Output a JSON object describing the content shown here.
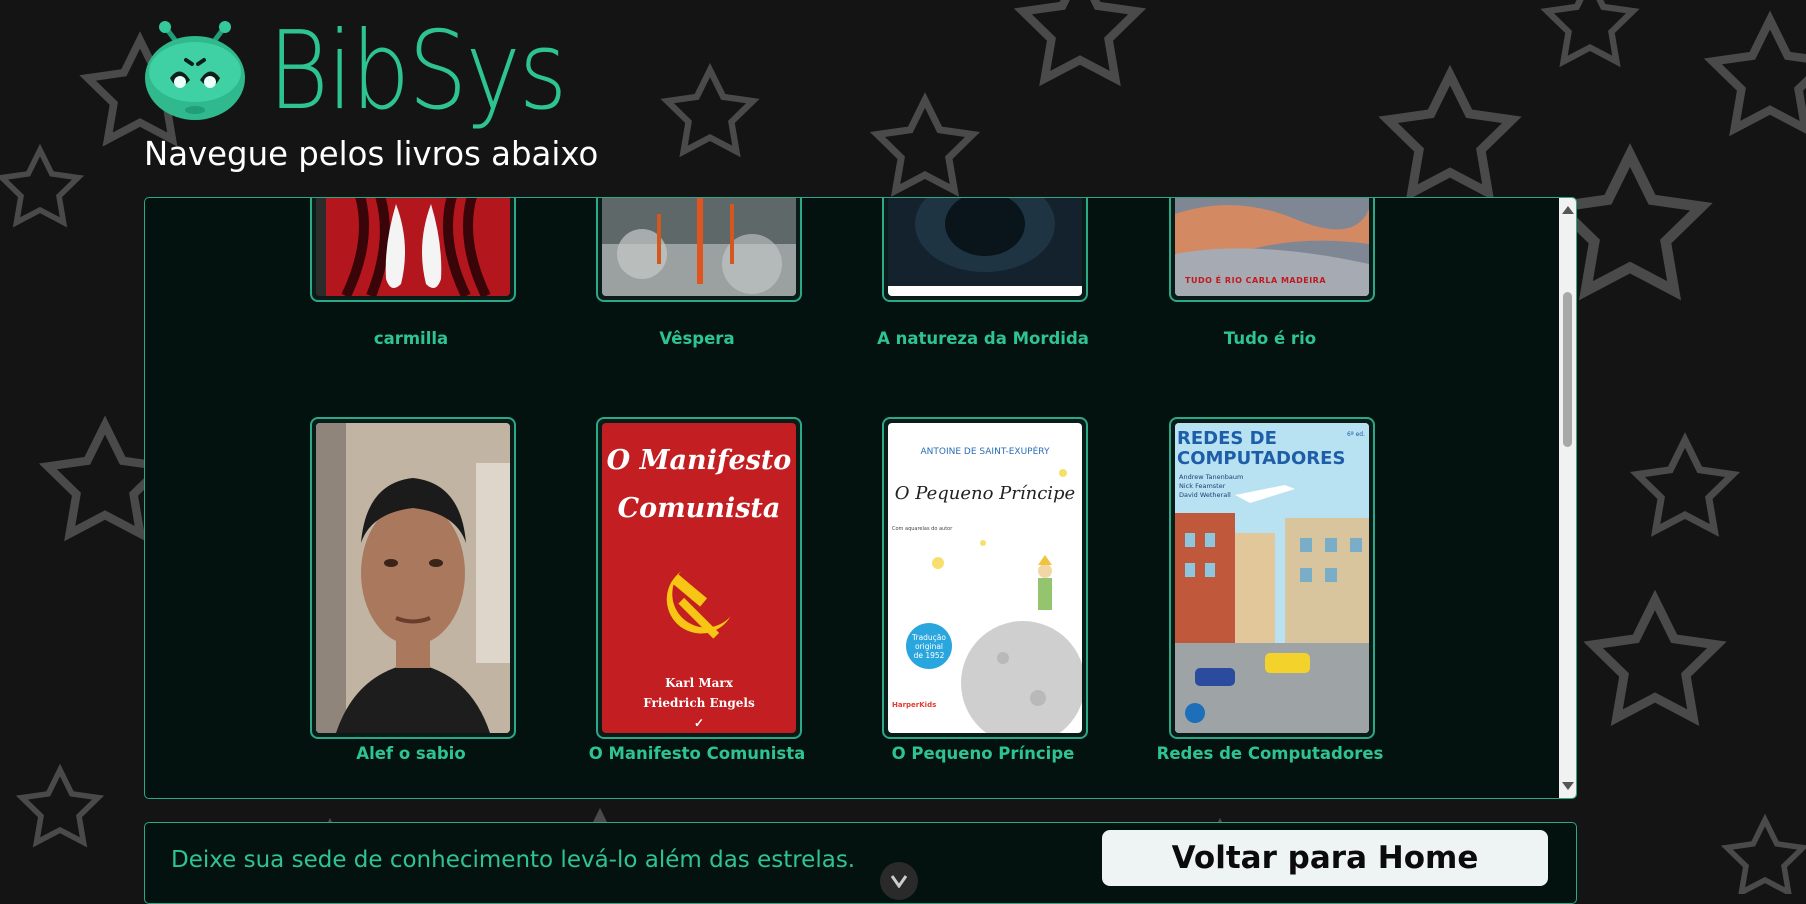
{
  "brand": {
    "name": "BibSys"
  },
  "page": {
    "subtitle": "Navegue pelos livros abaixo"
  },
  "books": [
    {
      "title": "carmilla"
    },
    {
      "title": "Vêspera"
    },
    {
      "title": "A natureza da Mordida"
    },
    {
      "title": "Tudo é rio"
    },
    {
      "title": "Alef o sabio"
    },
    {
      "title": "O Manifesto Comunista"
    },
    {
      "title": "O Pequeno Príncipe"
    },
    {
      "title": "Redes de Computadores"
    }
  ],
  "covers": {
    "tudo_e_rio": {
      "line": "TUDO É RIO CARLA MADEIRA"
    },
    "manifesto": {
      "title_line1": "O Manifesto",
      "title_line2": "Comunista",
      "author1": "Karl Marx",
      "author2": "Friedrich Engels"
    },
    "pequeno_principe": {
      "author": "ANTOINE DE SAINT-EXUPÉRY",
      "title": "O Pequeno Príncipe",
      "note": "Com aquarelas do autor",
      "badge_line1": "Tradução",
      "badge_line2": "original",
      "badge_line3": "de 1952",
      "publisher": "HarperKids"
    },
    "redes": {
      "title_line1": "REDES DE",
      "title_line2": "COMPUTADORES",
      "edition": "6ª ed.",
      "author1": "Andrew Tanenbaum",
      "author2": "Nick Feamster",
      "author3": "David Wetherall"
    }
  },
  "footer": {
    "tagline": "Deixe sua sede de conhecimento levá-lo além das estrelas.",
    "home_button": "Voltar para Home"
  },
  "colors": {
    "accent": "#2ec492",
    "border": "#2aa887",
    "panel_bg": "#04120f",
    "page_bg": "#141414"
  }
}
